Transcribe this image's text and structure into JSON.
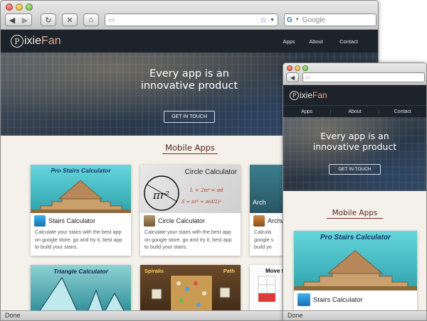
{
  "browser": {
    "search_placeholder": "Google",
    "status_text": "Done"
  },
  "site": {
    "logo_text": "ixie",
    "logo_accent": "Fan",
    "logo_glyph": "P",
    "nav": [
      "Apps",
      "About",
      "Contact"
    ],
    "hero_title_line1": "Every app is an",
    "hero_title_line2": "innovative product",
    "cta_label": "GET IN TOUCH",
    "section_title": "Mobile Apps"
  },
  "cards": [
    {
      "banner": "Pro Stairs Calculator",
      "title": "Stairs Calculator",
      "desc": "Calculate your stairs with the best app on google store. go and try it, best app to build your stairs."
    },
    {
      "banner": "Circle Calculator",
      "title": "Circle Calculator",
      "desc": "Calculate your stairs with the best app on google store. go and try it, best app to build your stairs.",
      "formula1": "L = 2πr = πd",
      "formula2": "S = πr² = π(d/2)²"
    },
    {
      "banner": "Arch",
      "title": "Archw",
      "desc": "Calcula google s build yo"
    },
    {
      "banner": "Triangle Calculator"
    },
    {
      "banner": "Spiralis",
      "banner2": "Path"
    },
    {
      "banner": "Move th"
    }
  ],
  "colors": {
    "accent": "#7b2a27",
    "nav_bg": "#1d232b",
    "page_bg": "#f4f1ea",
    "teal": "#3fb9c4",
    "stair": "#caa06c"
  }
}
